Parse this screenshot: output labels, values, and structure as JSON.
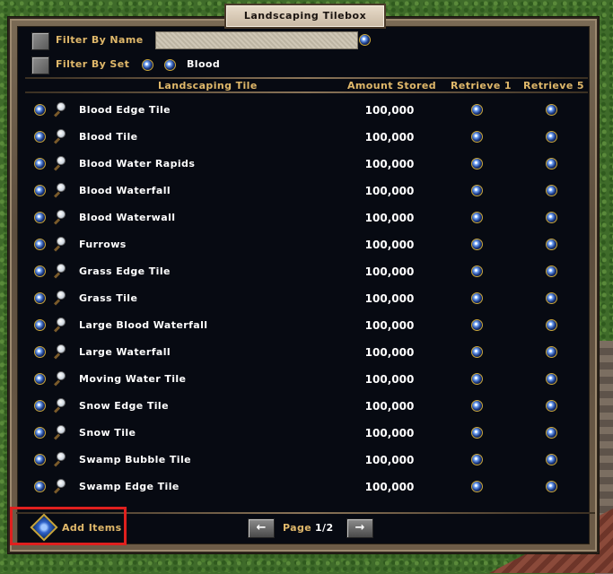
{
  "window": {
    "title": "Landscaping Tilebox"
  },
  "filters": {
    "by_name_label": "Filter By Name",
    "name_value": "",
    "by_set_label": "Filter By Set",
    "set_value": "Blood"
  },
  "table": {
    "headers": [
      "Landscaping Tile",
      "Amount Stored",
      "Retrieve 1",
      "Retrieve 5"
    ],
    "rows": [
      {
        "name": "Blood Edge Tile",
        "amount": "100,000"
      },
      {
        "name": "Blood Tile",
        "amount": "100,000"
      },
      {
        "name": "Blood Water Rapids",
        "amount": "100,000"
      },
      {
        "name": "Blood Waterfall",
        "amount": "100,000"
      },
      {
        "name": "Blood Waterwall",
        "amount": "100,000"
      },
      {
        "name": "Furrows",
        "amount": "100,000"
      },
      {
        "name": "Grass Edge Tile",
        "amount": "100,000"
      },
      {
        "name": "Grass Tile",
        "amount": "100,000"
      },
      {
        "name": "Large Blood Waterfall",
        "amount": "100,000"
      },
      {
        "name": "Large Waterfall",
        "amount": "100,000"
      },
      {
        "name": "Moving Water Tile",
        "amount": "100,000"
      },
      {
        "name": "Snow Edge Tile",
        "amount": "100,000"
      },
      {
        "name": "Snow Tile",
        "amount": "100,000"
      },
      {
        "name": "Swamp Bubble Tile",
        "amount": "100,000"
      },
      {
        "name": "Swamp Edge Tile",
        "amount": "100,000"
      }
    ]
  },
  "footer": {
    "add_items_label": "Add Items",
    "page_label": "Page",
    "page_value": "1/2"
  },
  "colors": {
    "panel_bg": "#070a12",
    "header_gold": "#e0b86a",
    "highlight_red": "#e0201e"
  }
}
